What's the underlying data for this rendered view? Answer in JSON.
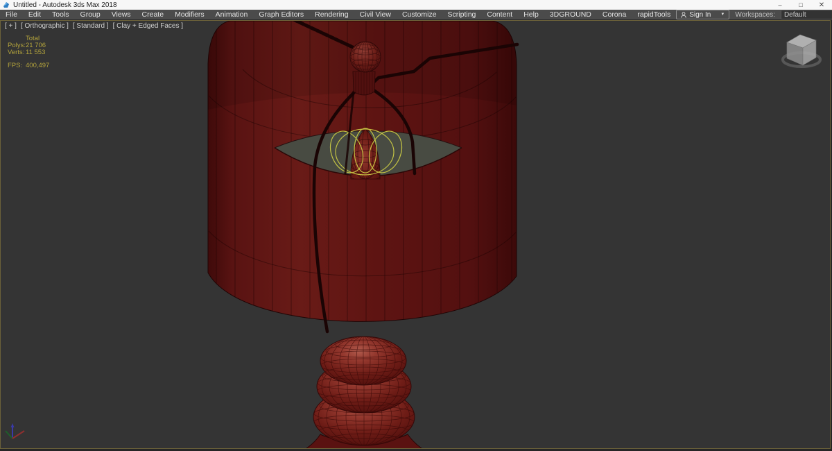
{
  "colors": {
    "titlebar_bg": "#f7f7f7",
    "menu_bg": "#4b4b4b",
    "menu_text": "#e2e2e2",
    "viewport_bg": "#343434",
    "viewport_border": "#6b6139",
    "stats_yellow": "#b4a43c",
    "label_gray": "#cfcfcf",
    "shade_red": "#5e1412",
    "bead_red": "#94382e",
    "wireframe_dark": "#230505",
    "light_web_yellow": "#caca45"
  },
  "window": {
    "title": "Untitled - Autodesk 3ds Max 2018",
    "minimize_glyph": "–",
    "maximize_glyph": "□",
    "close_glyph": "✕"
  },
  "menu_bar": {
    "items": [
      "File",
      "Edit",
      "Tools",
      "Group",
      "Views",
      "Create",
      "Modifiers",
      "Animation",
      "Graph Editors",
      "Rendering",
      "Civil View",
      "Customize",
      "Scripting",
      "Content",
      "Help",
      "3DGROUND",
      "Corona",
      "rapidTools"
    ],
    "sign_in_label": "Sign In",
    "sign_in_caret": "▼",
    "workspaces_label": "Workspaces:",
    "workspace_value": "Default",
    "workspace_caret": "▼"
  },
  "viewport": {
    "label_parts": [
      "[ + ]",
      "[ Orthographic ]",
      "[ Standard ]",
      "[ Clay + Edged Faces ]"
    ],
    "statistics": {
      "total_label": "Total",
      "polys_label": "Polys:",
      "polys_value": "21 706",
      "verts_label": "Verts:",
      "verts_value": "11 553",
      "fps_label": "FPS:",
      "fps_value": "400,497"
    }
  }
}
